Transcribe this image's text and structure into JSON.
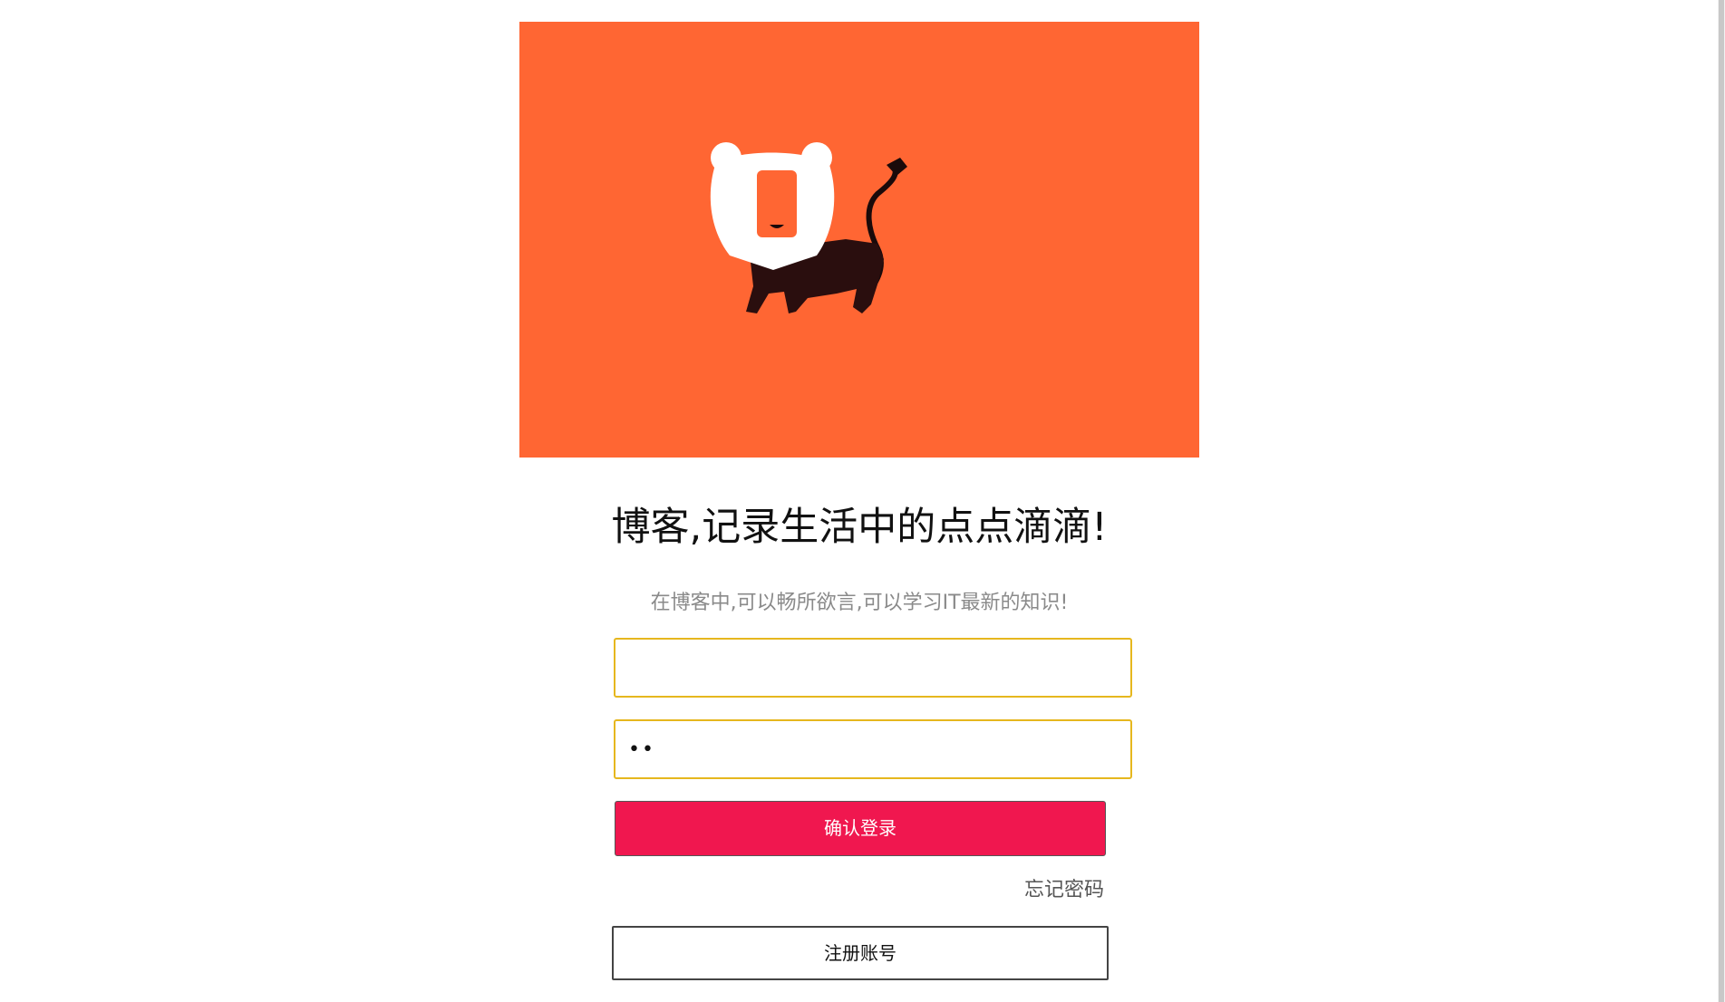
{
  "hero": {
    "background_color": "#ff6633",
    "illustration": "lion-mascot-icon"
  },
  "headline": "博客,记录生活中的点点滴滴!",
  "subtitle": "在博客中,可以畅所欲言,可以学习IT最新的知识!",
  "form": {
    "username": {
      "value": "",
      "placeholder": ""
    },
    "password": {
      "value": "••"
    },
    "login_label": "确认登录",
    "forgot_label": "忘记密码",
    "register_label": "注册账号"
  },
  "colors": {
    "hero": "#ff6633",
    "login_button": "#f0174f",
    "field_border": "#e6b71e"
  }
}
